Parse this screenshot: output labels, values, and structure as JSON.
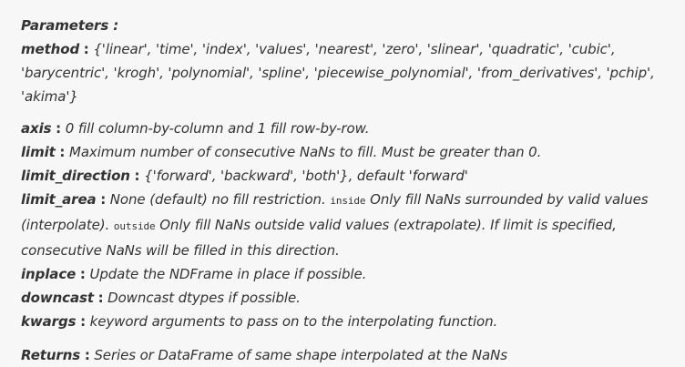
{
  "header": "Parameters :",
  "params": [
    {
      "name": "method",
      "desc": "{'linear', 'time', 'index', 'values', 'nearest', 'zero', 'slinear', 'quadratic', 'cubic', 'barycentric', 'krogh', 'polynomial', 'spline', 'piecewise_polynomial', 'from_derivatives', 'pchip', 'akima'}"
    },
    {
      "name": "axis",
      "desc": "0 fill column-by-column and 1 fill row-by-row."
    },
    {
      "name": "limit",
      "desc": "Maximum number of consecutive NaNs to fill. Must be greater than 0."
    },
    {
      "name": "limit_direction",
      "desc": "{'forward', 'backward', 'both'}, default 'forward'"
    },
    {
      "name": "limit_area",
      "desc_1": "None (default) no fill restriction.",
      "code_1": "inside",
      "desc_2": "Only fill NaNs surrounded by valid values (interpolate).",
      "code_2": "outside",
      "desc_3": "Only fill NaNs outside valid values (extrapolate). If limit is specified, consecutive NaNs will be filled in this direction."
    },
    {
      "name": "inplace",
      "desc": "Update the NDFrame in place if possible."
    },
    {
      "name": "downcast",
      "desc": "Downcast dtypes if possible."
    },
    {
      "name": "kwargs",
      "desc": "keyword arguments to pass on to the interpolating function."
    }
  ],
  "returns": {
    "name": "Returns",
    "desc": "Series or DataFrame of same shape interpolated at the NaNs"
  },
  "separator": ":"
}
